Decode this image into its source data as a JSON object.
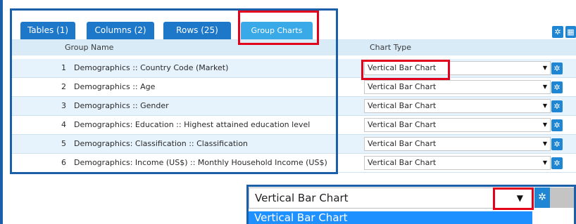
{
  "tabs": [
    {
      "label": "Tables (1)"
    },
    {
      "label": "Columns (2)"
    },
    {
      "label": "Rows (25)"
    },
    {
      "label": "Group Charts"
    }
  ],
  "header": {
    "group_name": "Group Name",
    "chart_type": "Chart Type"
  },
  "rows": [
    {
      "num": "1",
      "name": "Demographics :: Country Code (Market)",
      "chart_type": "Vertical Bar Chart"
    },
    {
      "num": "2",
      "name": "Demographics :: Age",
      "chart_type": "Vertical Bar Chart"
    },
    {
      "num": "3",
      "name": "Demographics :: Gender",
      "chart_type": "Vertical Bar Chart"
    },
    {
      "num": "4",
      "name": "Demographics: Education :: Highest attained education level",
      "chart_type": "Vertical Bar Chart"
    },
    {
      "num": "5",
      "name": "Demographics: Classification :: Classification",
      "chart_type": "Vertical Bar Chart"
    },
    {
      "num": "6",
      "name": "Demographics: Income (US$) :: Monthly Household Income (US$)",
      "chart_type": "Vertical Bar Chart"
    }
  ],
  "zoom": {
    "selected": "Vertical Bar Chart",
    "highlighted_option": "Vertical Bar Chart"
  },
  "icons": {
    "gear": "gear-icon",
    "dropdown": "dropdown-arrow-icon",
    "grid": "grid-icon"
  },
  "colors": {
    "tab": "#1d78c9",
    "tab_active": "#39a9e8",
    "header_bg": "#d8ebf7",
    "row_alt": "#e7f3fc",
    "annotation_blue": "#1b5fa8",
    "annotation_red": "#e3001b",
    "option_highlight": "#1e90ff"
  }
}
